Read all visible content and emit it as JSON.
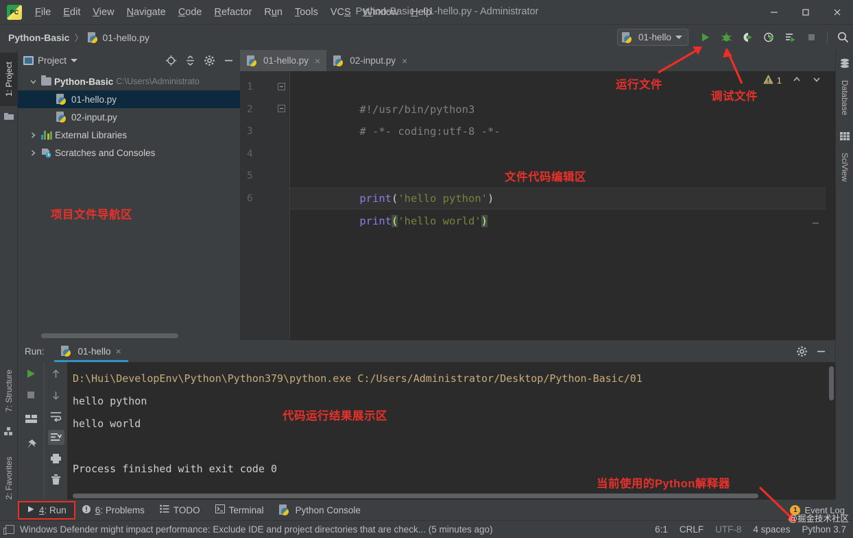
{
  "window": {
    "title": "Python-Basic - 01-hello.py - Administrator",
    "logo_text": "PC",
    "minimize": "—",
    "maximize": "□",
    "close": "✕"
  },
  "menu": [
    {
      "label": "File",
      "mnemonic": "F"
    },
    {
      "label": "Edit",
      "mnemonic": "E"
    },
    {
      "label": "View",
      "mnemonic": "V"
    },
    {
      "label": "Navigate",
      "mnemonic": "N"
    },
    {
      "label": "Code",
      "mnemonic": "C"
    },
    {
      "label": "Refactor",
      "mnemonic": "R"
    },
    {
      "label": "Run",
      "mnemonic": "u"
    },
    {
      "label": "Tools",
      "mnemonic": "T"
    },
    {
      "label": "VCS",
      "mnemonic": "S"
    },
    {
      "label": "Window",
      "mnemonic": "W"
    },
    {
      "label": "Help",
      "mnemonic": "H"
    }
  ],
  "navbar": {
    "breadcrumb_project": "Python-Basic",
    "breadcrumb_sep": "〉",
    "breadcrumb_file": "01-hello.py",
    "run_config": "01-hello",
    "icons": [
      "run-icon",
      "debug-icon",
      "run-coverage-icon",
      "profile-icon",
      "run-with-console-icon",
      "stop-icon",
      "search-icon"
    ]
  },
  "left_strip": {
    "project": "1: Project",
    "structure": "7: Structure",
    "favorites": "2: Favorites"
  },
  "right_strip": {
    "database": "Database",
    "sciview": "SciView"
  },
  "project_panel": {
    "title": "Project",
    "header_icons": [
      "locate-icon",
      "collapse-all-icon",
      "settings-icon",
      "hide-icon"
    ],
    "tree": [
      {
        "label": "Python-Basic",
        "path": "C:\\Users\\Administrato",
        "level": 0,
        "icon": "folder-icon",
        "expanded": true,
        "bold": true,
        "selected": false
      },
      {
        "label": "01-hello.py",
        "path": "",
        "level": 1,
        "icon": "python-file-icon",
        "expanded": null,
        "bold": false,
        "selected": true
      },
      {
        "label": "02-input.py",
        "path": "",
        "level": 1,
        "icon": "python-file-icon",
        "expanded": null,
        "bold": false,
        "selected": false
      },
      {
        "label": "External Libraries",
        "path": "",
        "level": 0,
        "icon": "libraries-icon",
        "expanded": false,
        "bold": false,
        "selected": false
      },
      {
        "label": "Scratches and Consoles",
        "path": "",
        "level": 0,
        "icon": "scratches-icon",
        "expanded": false,
        "bold": false,
        "selected": false
      }
    ]
  },
  "editor": {
    "tabs": [
      {
        "label": "01-hello.py",
        "active": true,
        "close": "×"
      },
      {
        "label": "02-input.py",
        "active": false,
        "close": "×"
      }
    ],
    "line_numbers": [
      "1",
      "2",
      "3",
      "4",
      "5",
      "6"
    ],
    "lines": [
      {
        "n": "1",
        "kind": "comment",
        "text": "#!/usr/bin/python3",
        "fold": "minus-square",
        "current": false
      },
      {
        "n": "2",
        "kind": "comment",
        "text": "# -*- coding:utf-8 -*-",
        "fold": "minus-square",
        "current": false
      },
      {
        "n": "3",
        "kind": "blank",
        "text": "",
        "fold": "",
        "current": false
      },
      {
        "n": "4",
        "kind": "blank",
        "text": "",
        "fold": "",
        "current": false
      },
      {
        "n": "5",
        "kind": "code",
        "fn": "print",
        "open": "(",
        "str": "'hello python'",
        "close": ")",
        "current": false
      },
      {
        "n": "6",
        "kind": "code",
        "fn": "print",
        "open": "(",
        "str": "'hello world'",
        "close": ")",
        "current": true
      }
    ],
    "warning_count": "1",
    "warning_icon": "warning-triangle-icon",
    "nav_up": "∧",
    "nav_down": "∨"
  },
  "run_panel": {
    "label": "Run:",
    "tab": "01-hello",
    "tab_close": "×",
    "header_icons": [
      "settings-icon",
      "hide-icon"
    ],
    "tools_left": [
      "rerun-icon",
      "stop-icon",
      "layout-icon",
      "pin-icon"
    ],
    "tools_right": [
      "up-icon",
      "down-icon",
      "soft-wrap-icon",
      "scroll-to-end-icon",
      "print-icon",
      "trash-icon"
    ],
    "output": [
      {
        "kind": "path",
        "text": "D:\\Hui\\DevelopEnv\\Python\\Python379\\python.exe C:/Users/Administrator/Desktop/Python-Basic/01"
      },
      {
        "kind": "out",
        "text": "hello python"
      },
      {
        "kind": "out",
        "text": "hello world"
      },
      {
        "kind": "blank",
        "text": ""
      },
      {
        "kind": "out",
        "text": "Process finished with exit code 0"
      }
    ]
  },
  "bottom_tools": [
    {
      "label": "4: Run",
      "mnemonic": "4",
      "icon": "run-icon",
      "boxed": true
    },
    {
      "label": "6: Problems",
      "mnemonic": "6",
      "icon": "problems-icon",
      "boxed": false
    },
    {
      "label": "TODO",
      "mnemonic": "",
      "icon": "todo-icon",
      "boxed": false
    },
    {
      "label": "Terminal",
      "mnemonic": "",
      "icon": "terminal-icon",
      "boxed": false
    },
    {
      "label": "Python Console",
      "mnemonic": "",
      "icon": "python-console-icon",
      "boxed": false
    }
  ],
  "event_log": {
    "badge": "1",
    "label": "Event Log"
  },
  "status_bar": {
    "message": "Windows Defender might impact performance: Exclude IDE and project directories that are check... (5 minutes ago)",
    "caret": "6:1",
    "line_sep": "CRLF",
    "encoding": "UTF-8",
    "indent": "4 spaces",
    "interpreter": "Python 3.7"
  },
  "annotations": [
    {
      "id": "nav-area",
      "text": "项目文件导航区"
    },
    {
      "id": "run-file",
      "text": "运行文件"
    },
    {
      "id": "debug-file",
      "text": "调试文件"
    },
    {
      "id": "code-edit-area",
      "text": "文件代码编辑区"
    },
    {
      "id": "result-area",
      "text": "代码运行结果展示区"
    },
    {
      "id": "interpreter",
      "text": "当前使用的Python解释器"
    }
  ],
  "watermark": "@掘金技术社区",
  "colors": {
    "accent": "#3592c4",
    "annotation": "#e8312a",
    "run_green": "#4a9c3f",
    "editor_bg": "#2b2b2b",
    "panel_bg": "#3c3f41"
  }
}
